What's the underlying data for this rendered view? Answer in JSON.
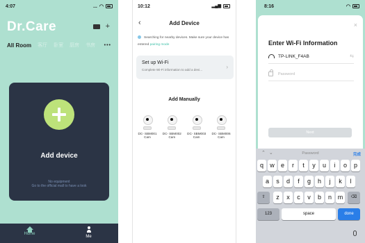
{
  "phone1": {
    "time": "4:07",
    "status_dots": "...",
    "brand": "Dr.Care",
    "rooms": [
      "All Room",
      "客厅",
      "卧室",
      "厨房",
      "书房"
    ],
    "more": "•••",
    "card": {
      "label": "Add device",
      "empty_line1": "No equipment",
      "empty_line2": "Go to the official mall to have a look"
    },
    "tabbar": {
      "home": "Home",
      "me": "Me"
    }
  },
  "phone2": {
    "time": "10:12",
    "title": "Add Device",
    "notice_text": "Searching for nearby devices. Make sure your device has entered",
    "notice_link": "pairing mode",
    "setup": {
      "title": "Set up Wi-Fi",
      "subtitle": "Complete Wi-Fi information to add a devi..."
    },
    "add_manually": "Add Manually",
    "devices": [
      {
        "line1": "DC- SBM001",
        "line2": "Cam"
      },
      {
        "line1": "DC- SBM002",
        "line2": "Cam"
      },
      {
        "line1": "DC- SBM003",
        "line2": "Cam"
      },
      {
        "line1": "DC- SBM006",
        "line2": "Cam"
      }
    ]
  },
  "phone3": {
    "time": "8:16",
    "sheet": {
      "title": "Enter Wi-Fi Information",
      "ssid": "TP-LINK_F4AB",
      "password_placeholder": "Password",
      "next": "Next"
    },
    "keyboard": {
      "bar_label": "Password",
      "bar_done": "完成",
      "row1": [
        "q",
        "w",
        "e",
        "r",
        "t",
        "y",
        "u",
        "i",
        "o",
        "p"
      ],
      "row2": [
        "a",
        "s",
        "d",
        "f",
        "g",
        "h",
        "j",
        "k",
        "l"
      ],
      "row3": [
        "z",
        "x",
        "c",
        "v",
        "b",
        "n",
        "m"
      ],
      "num": "123",
      "space": "space",
      "done": "done",
      "shift": "⇧",
      "backspace": "⌫"
    }
  }
}
